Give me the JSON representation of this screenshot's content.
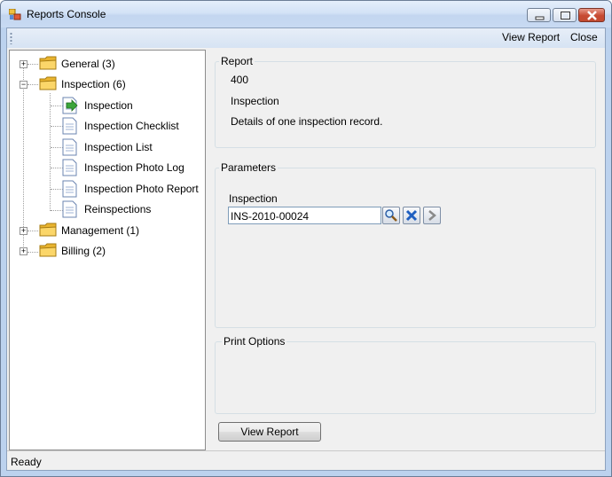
{
  "window": {
    "title": "Reports Console",
    "icon": "report-app-icon",
    "controls": [
      "minimize-icon",
      "maximize-icon",
      "close-icon"
    ]
  },
  "menu": {
    "view_report": "View Report",
    "close": "Close"
  },
  "tree": {
    "groups": [
      {
        "label": "General (3)",
        "expanded": false
      },
      {
        "label": "Inspection (6)",
        "expanded": true,
        "children": [
          {
            "label": "Inspection",
            "selected": true
          },
          {
            "label": "Inspection Checklist"
          },
          {
            "label": "Inspection List"
          },
          {
            "label": "Inspection Photo Log"
          },
          {
            "label": "Inspection Photo Report"
          },
          {
            "label": "Reinspections"
          }
        ]
      },
      {
        "label": "Management (1)",
        "expanded": false
      },
      {
        "label": "Billing (2)",
        "expanded": false
      }
    ]
  },
  "report": {
    "group_title": "Report",
    "number": "400",
    "name": "Inspection",
    "description": "Details of one inspection record."
  },
  "parameters": {
    "group_title": "Parameters",
    "field_label": "Inspection",
    "field_value": "INS-2010-00024",
    "buttons": [
      "search-icon",
      "clear-x-icon",
      "next-arrow-icon"
    ]
  },
  "print_options": {
    "group_title": "Print Options"
  },
  "actions": {
    "view_report": "View Report"
  },
  "status": {
    "text": "Ready"
  },
  "colors": {
    "title_bar": "#c3d6f0",
    "close_button": "#c74a32",
    "folder": "#f3c64a",
    "selected_arrow": "#3aa53a",
    "clear_x": "#1f5fc0"
  }
}
